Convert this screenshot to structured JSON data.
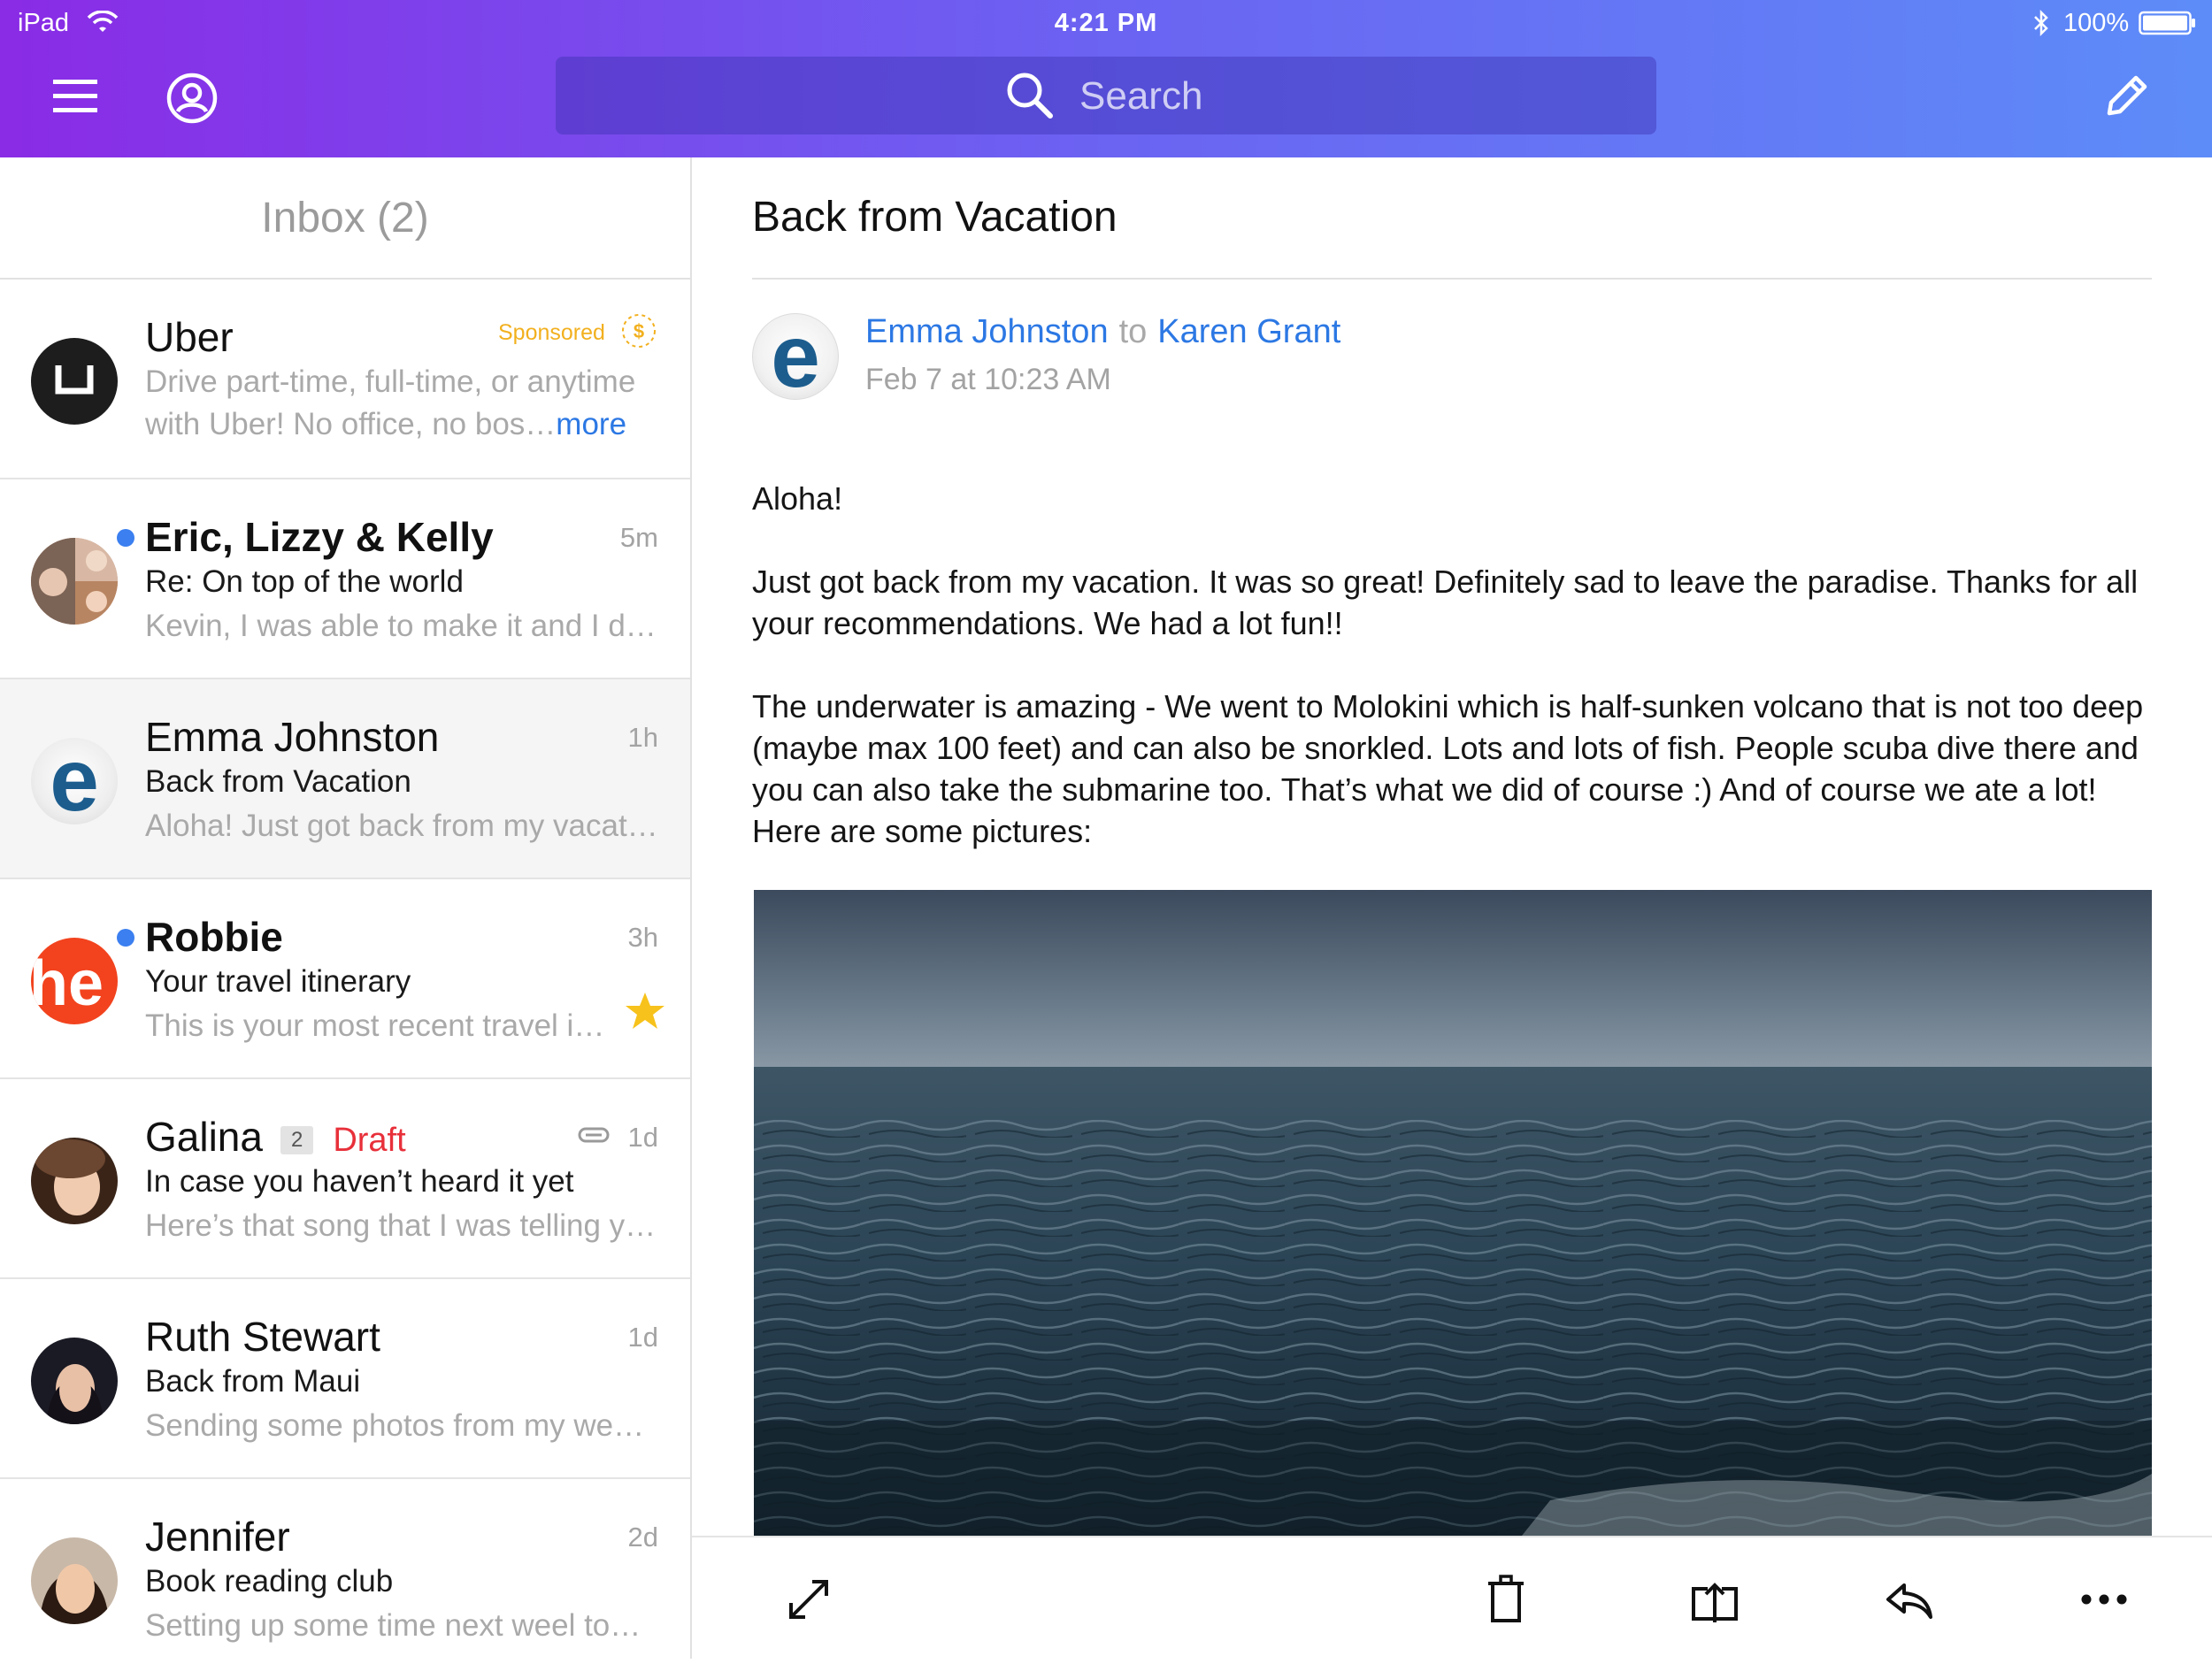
{
  "status_bar": {
    "device": "iPad",
    "time": "4:21 PM",
    "battery": "100%"
  },
  "search": {
    "placeholder": "Search"
  },
  "inbox": {
    "title": "Inbox (2)",
    "messages": [
      {
        "sender": "Uber",
        "sponsored_label": "Sponsored",
        "preview": "Drive part-time, full-time, or anytime with Uber! No office, no bos…",
        "more_label": "more",
        "avatar_icon": "uber-logo"
      },
      {
        "sender": "Eric, Lizzy & Kelly",
        "time": "5m",
        "subject": "Re: On top of the world",
        "preview": "Kevin, I was able to make it and I do…",
        "unread": true
      },
      {
        "sender": "Emma Johnston",
        "time": "1h",
        "subject": "Back from Vacation",
        "preview": "Aloha! Just got back from my vacati…",
        "selected": true
      },
      {
        "sender": "Robbie",
        "time": "3h",
        "subject": "Your travel itinerary",
        "preview": "This is your most recent travel in…",
        "unread": true,
        "starred": true,
        "avatar_text": "he"
      },
      {
        "sender": "Galina",
        "count": "2",
        "draft_label": "Draft",
        "time": "1d",
        "subject": "In case you haven’t heard it yet",
        "preview": "Here’s that song that I was telling yo…",
        "has_attachment": true
      },
      {
        "sender": "Ruth Stewart",
        "time": "1d",
        "subject": "Back from Maui",
        "preview": "Sending some photos from my wee…"
      },
      {
        "sender": "Jennifer",
        "time": "2d",
        "subject": "Book reading club",
        "preview": "Setting up some time next weel to…"
      }
    ]
  },
  "message": {
    "title": "Back from Vacation",
    "from": "Emma Johnston",
    "to_word": "to",
    "to": "Karen Grant",
    "date": "Feb 7 at 10:23 AM",
    "body": [
      "Aloha!",
      "Just got back from my vacation. It was so great! Definitely sad to leave the paradise. Thanks for all your recommendations. We had a lot fun!!",
      "The underwater is amazing - We went to Molokini which is half-sunken volcano that is not too deep (maybe max 100 feet) and can also be snorkled. Lots and lots of fish. People scuba dive there and you can also take the submarine too. That’s what we did of course :) And of course we ate a lot! Here are some pictures:"
    ],
    "photo": "ocean-photo"
  },
  "colors": {
    "header_gradient_start": "#8a2be6",
    "header_gradient_end": "#5d8cf8",
    "link_blue": "#2c78e4",
    "unread_dot": "#3b7ff0",
    "sponsored": "#f2b01e",
    "draft": "#e8303a",
    "star": "#f7c21b"
  },
  "toolbar": {
    "icons": [
      "expand-icon",
      "trash-icon",
      "move-to-folder-icon",
      "reply-icon",
      "more-icon"
    ]
  }
}
